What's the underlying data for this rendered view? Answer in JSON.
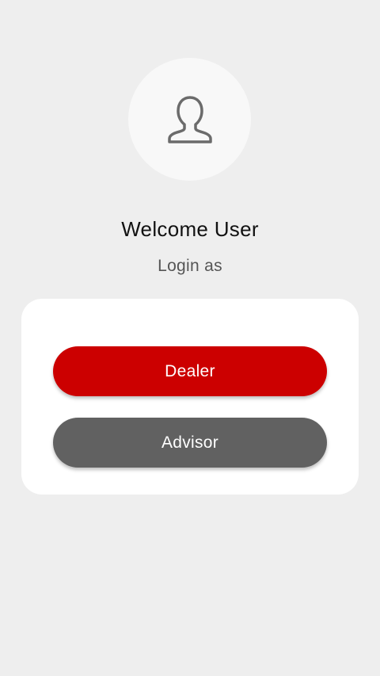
{
  "avatar": {
    "icon": "user-icon"
  },
  "header": {
    "title": "Welcome User",
    "subtitle": "Login as"
  },
  "login_options": [
    {
      "label": "Dealer",
      "color": "#cc0000"
    },
    {
      "label": "Advisor",
      "color": "#616161"
    }
  ],
  "colors": {
    "background": "#eeeeee",
    "card": "#ffffff",
    "dealer_button": "#cc0000",
    "advisor_button": "#616161"
  }
}
